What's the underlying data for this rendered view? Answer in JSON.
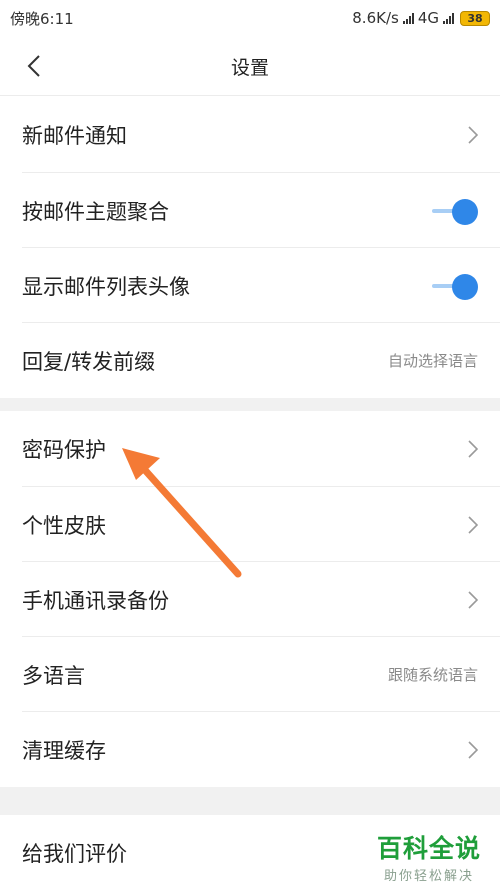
{
  "status": {
    "time": "傍晚6:11",
    "speed": "8.6K/s",
    "network": "4G",
    "battery": "38"
  },
  "header": {
    "title": "设置"
  },
  "settings": {
    "new_mail": {
      "label": "新邮件通知"
    },
    "group_by_subject": {
      "label": "按邮件主题聚合",
      "enabled": true
    },
    "show_avatar": {
      "label": "显示邮件列表头像",
      "enabled": true
    },
    "reply_prefix": {
      "label": "回复/转发前缀",
      "value": "自动选择语言"
    },
    "password": {
      "label": "密码保护"
    },
    "skin": {
      "label": "个性皮肤"
    },
    "contacts_backup": {
      "label": "手机通讯录备份"
    },
    "language": {
      "label": "多语言",
      "value": "跟随系统语言"
    },
    "clear_cache": {
      "label": "清理缓存"
    },
    "rate_us": {
      "label": "给我们评价"
    }
  },
  "watermark": {
    "title": "百科全说",
    "subtitle": "助你轻松解决"
  },
  "colors": {
    "accent": "#2f87e8",
    "annotation": "#f47a35",
    "watermark": "#1f9e3a"
  }
}
